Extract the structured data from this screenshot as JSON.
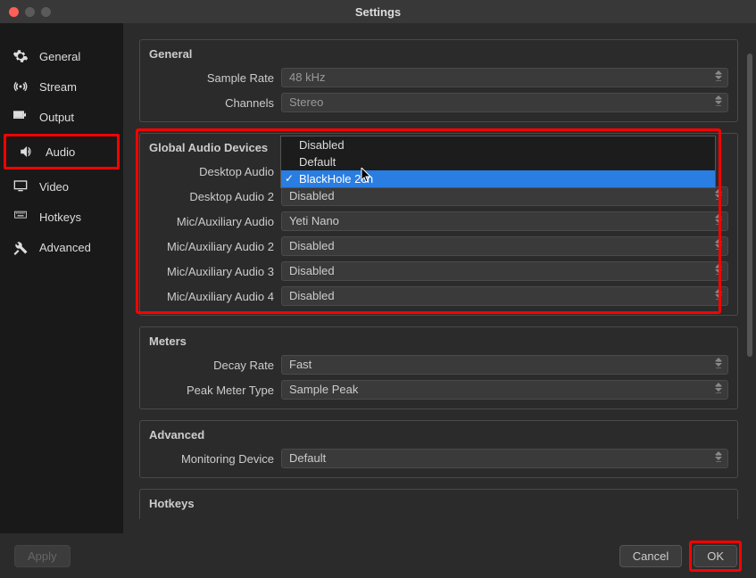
{
  "window": {
    "title": "Settings"
  },
  "sidebar": {
    "items": [
      {
        "label": "General"
      },
      {
        "label": "Stream"
      },
      {
        "label": "Output"
      },
      {
        "label": "Audio"
      },
      {
        "label": "Video"
      },
      {
        "label": "Hotkeys"
      },
      {
        "label": "Advanced"
      }
    ]
  },
  "sections": {
    "general": {
      "title": "General",
      "sample_rate_label": "Sample Rate",
      "sample_rate_value": "48 kHz",
      "channels_label": "Channels",
      "channels_value": "Stereo"
    },
    "global_audio": {
      "title": "Global Audio Devices",
      "desktop_audio_label": "Desktop Audio",
      "desktop_audio_dropdown": {
        "options": [
          "Disabled",
          "Default",
          "BlackHole 2ch"
        ],
        "selected": "BlackHole 2ch"
      },
      "desktop_audio2_label": "Desktop Audio 2",
      "desktop_audio2_value": "Disabled",
      "mic1_label": "Mic/Auxiliary Audio",
      "mic1_value": "Yeti Nano",
      "mic2_label": "Mic/Auxiliary Audio 2",
      "mic2_value": "Disabled",
      "mic3_label": "Mic/Auxiliary Audio 3",
      "mic3_value": "Disabled",
      "mic4_label": "Mic/Auxiliary Audio 4",
      "mic4_value": "Disabled"
    },
    "meters": {
      "title": "Meters",
      "decay_label": "Decay Rate",
      "decay_value": "Fast",
      "peak_label": "Peak Meter Type",
      "peak_value": "Sample Peak"
    },
    "advanced": {
      "title": "Advanced",
      "monitoring_label": "Monitoring Device",
      "monitoring_value": "Default"
    },
    "hotkeys": {
      "title": "Hotkeys"
    }
  },
  "footer": {
    "apply": "Apply",
    "cancel": "Cancel",
    "ok": "OK"
  },
  "annotations": {
    "highlight_color": "#ff0000"
  }
}
